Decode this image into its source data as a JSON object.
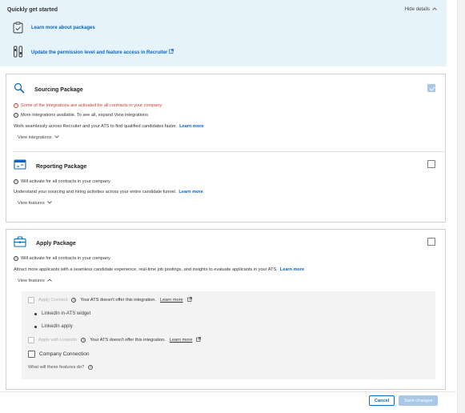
{
  "quick_start": {
    "title": "Quickly get started",
    "hide_details": "Hide details",
    "link_packages": "Learn more about packages",
    "link_permission": "Update the permission level and feature access in Recruiter"
  },
  "packages": {
    "sourcing": {
      "title": "Sourcing Package",
      "checked": true,
      "warning": "Some of the integrations are activated for all contracts in your company",
      "info": "More integrations available. To see all, expand View integrations",
      "description": "Work seamlessly across Recruiter and your ATS to find qualified candidates faster.",
      "learn_more": "Learn more",
      "toggle": "View integrations"
    },
    "reporting": {
      "title": "Reporting Package",
      "checked": false,
      "info": "Will activate for all contracts in your company",
      "description": "Understand your sourcing and hiring activities across your entire candidate funnel.",
      "learn_more": "Learn more",
      "toggle": "View features"
    },
    "apply": {
      "title": "Apply Package",
      "checked": false,
      "info": "Will activate for all contracts in your company",
      "description": "Attract more applicants with a seamless candidate experience, real-time job postings, and insights to evaluate applicants in your ATS.",
      "learn_more": "Learn more",
      "toggle": "View features",
      "features": {
        "apply_connect": "Apply Connect",
        "apply_connect_note": "Your ATS doesn't offer this integration.",
        "apply_connect_learn": "Learn more",
        "bullet_1": "LinkedIn in-ATS widget",
        "bullet_2": "LinkedIn apply",
        "apply_with_linkedin": "Apply with LinkedIn",
        "apply_with_linkedin_note": "Your ATS doesn't offer this integration.",
        "apply_with_linkedin_learn": "Learn more",
        "company_connection": "Company Connection",
        "what_features": "What will these features do?"
      }
    }
  },
  "footer": {
    "cancel": "Cancel",
    "save": "Save changes"
  },
  "colors": {
    "link": "#0a66c2",
    "warning": "#c4402f",
    "panel_bg": "#e6f3fb",
    "disabled_primary": "#a9c8e6"
  }
}
